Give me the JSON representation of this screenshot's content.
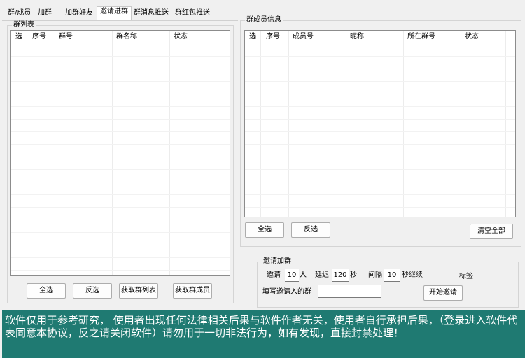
{
  "tabs": [
    "群/成员",
    "加群",
    "加群好友",
    "邀请进群",
    "群消息推送",
    "群红包推送"
  ],
  "group_list": {
    "title": "群列表",
    "columns": [
      "选",
      "序号",
      "群号",
      "群名称",
      "状态"
    ],
    "buttons": {
      "select_all": "全选",
      "invert": "反选",
      "fetch_groups": "获取群列表",
      "fetch_members": "获取群成员"
    }
  },
  "member_info": {
    "title": "群成员信息",
    "columns": [
      "选",
      "序号",
      "成员号",
      "昵称",
      "所在群号",
      "状态"
    ],
    "buttons": {
      "select_all": "全选",
      "invert": "反选",
      "clear_all": "清空全部"
    }
  },
  "invite": {
    "title": "邀请加群",
    "invite_label": "邀请",
    "invite_count": "10",
    "person_unit": "人",
    "delay_label": "延迟",
    "delay_value": "120",
    "sec_unit": "秒",
    "interval_label": "间隔",
    "interval_value": "10",
    "continue_label": "秒继续",
    "tag_label": "标签",
    "target_label": "填写邀请入的群",
    "target_value": "",
    "start_button": "开始邀请"
  },
  "notice": "软件仅用于参考研究，  使用者出现任何法律相关后果与软件作者无关，使用者自行承担后果，（登录进入软件代表同意本协议，反之请关闭软件）请勿用于一切非法行为，如有发现，直接封禁处理！"
}
